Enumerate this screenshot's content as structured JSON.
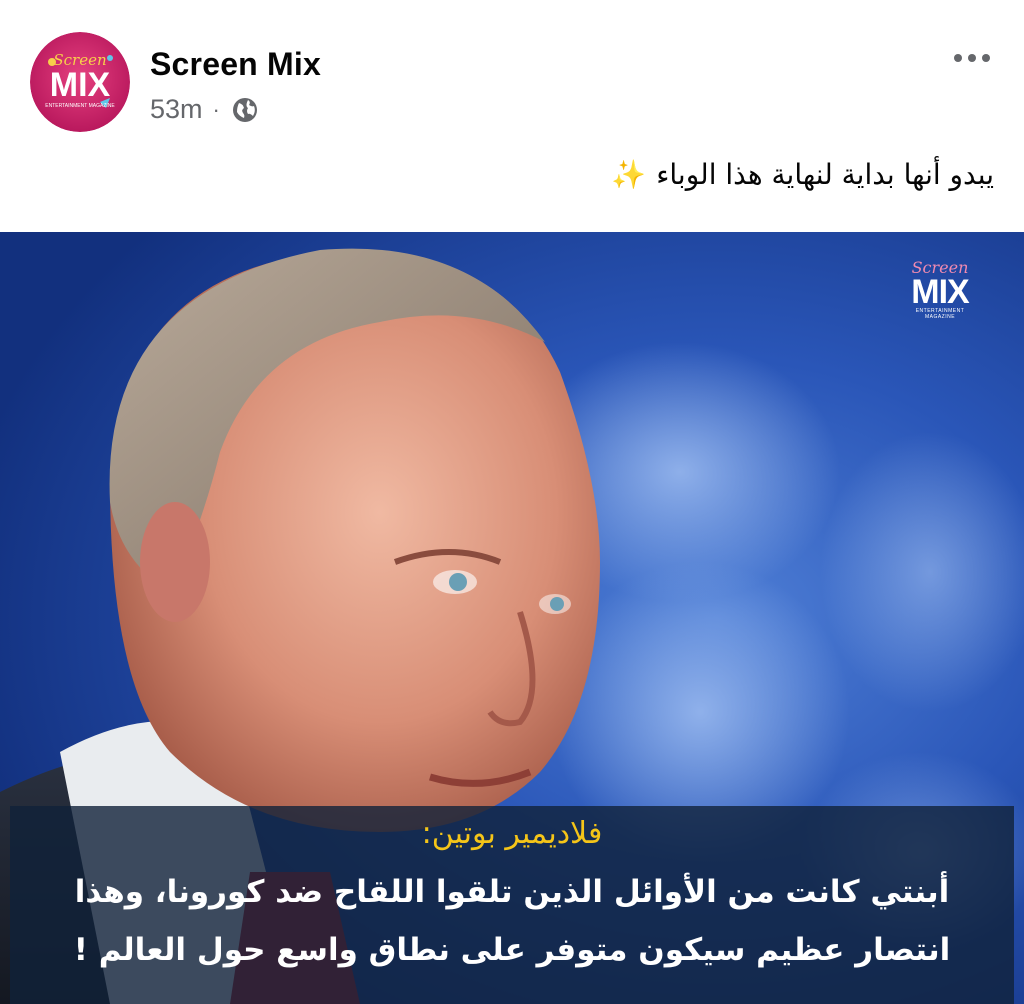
{
  "post": {
    "page_name": "Screen Mix",
    "time_ago": "53m",
    "separator": "·",
    "privacy_icon": "globe-icon",
    "more_icon": "more-dots-icon",
    "caption": "يبدو أنها بداية لنهاية هذا الوباء",
    "caption_emoji": "✨"
  },
  "avatar": {
    "script": "Screen",
    "brand": "MIX",
    "tagline": "ENTERTAINMENT MAGAZINE"
  },
  "image": {
    "watermark_script": "Screen",
    "watermark_brand": "MIX",
    "watermark_sub": "ENTERTAINMENT MAGAZINE",
    "quote_speaker": "فلاديمير بوتين:",
    "quote_line_1": "أبنتي كانت من الأوائل الذين تلقوا اللقاح ضد كورونا، وهذا",
    "quote_line_2": "انتصار عظيم سيكون متوفر على نطاق واسع حول العالم !"
  },
  "colors": {
    "avatar_bg": "#c2185b",
    "quote_speaker": "#f5c518",
    "image_bg": "#1e4aa8"
  }
}
